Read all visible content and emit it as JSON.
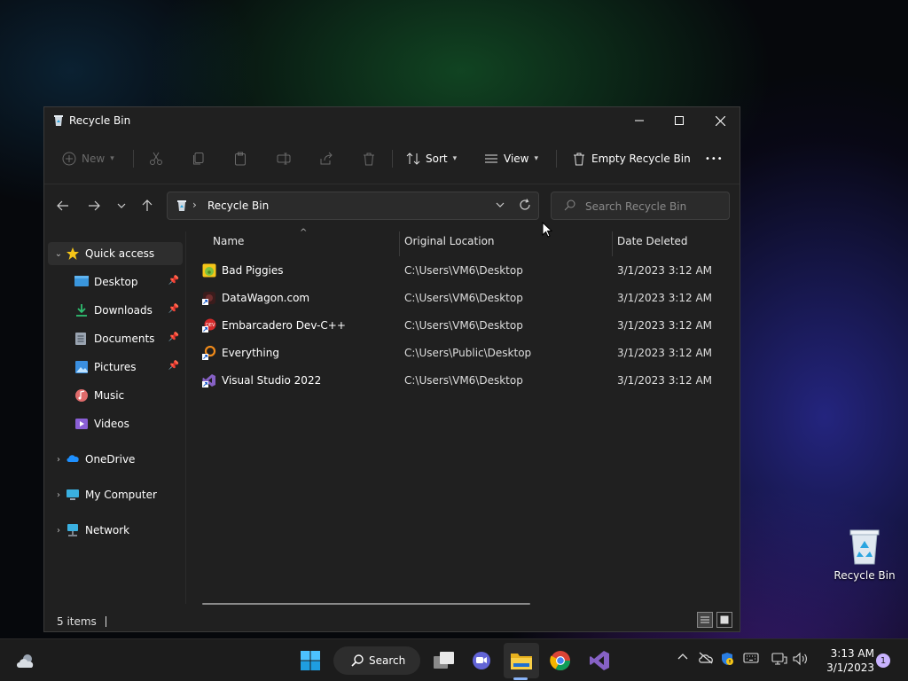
{
  "window": {
    "title": "Recycle Bin",
    "controls": {
      "minimize": "—",
      "maximize": "☐",
      "close": "✕"
    }
  },
  "toolbar": {
    "new_label": "New",
    "sort_label": "Sort",
    "view_label": "View",
    "empty_label": "Empty Recycle Bin",
    "more_label": "•••"
  },
  "address": {
    "path": "Recycle Bin",
    "search_placeholder": "Search Recycle Bin"
  },
  "sidebar": {
    "quick_access": "Quick access",
    "pinned": [
      {
        "label": "Desktop",
        "icon": "desktop-folder-icon",
        "color": "#3a96dd"
      },
      {
        "label": "Downloads",
        "icon": "downloads-folder-icon",
        "color": "#2fbf71"
      },
      {
        "label": "Documents",
        "icon": "documents-folder-icon",
        "color": "#9aa4b1"
      },
      {
        "label": "Pictures",
        "icon": "pictures-folder-icon",
        "color": "#3a8fe0"
      },
      {
        "label": "Music",
        "icon": "music-folder-icon",
        "color": "#e06b6b"
      },
      {
        "label": "Videos",
        "icon": "videos-folder-icon",
        "color": "#8a5fd6"
      }
    ],
    "onedrive": "OneDrive",
    "my_computer": "My Computer",
    "network": "Network"
  },
  "columns": {
    "name": "Name",
    "location": "Original Location",
    "date": "Date Deleted"
  },
  "files": [
    {
      "name": "Bad Piggies",
      "location": "C:\\Users\\VM6\\Desktop",
      "date": "3/1/2023 3:12 AM",
      "icon": "bad-piggies-icon",
      "color": "#7cc242"
    },
    {
      "name": "DataWagon.com",
      "location": "C:\\Users\\VM6\\Desktop",
      "date": "3/1/2023 3:12 AM",
      "icon": "datawagon-icon",
      "color": "#5a2a2a"
    },
    {
      "name": "Embarcadero Dev-C++",
      "location": "C:\\Users\\VM6\\Desktop",
      "date": "3/1/2023 3:12 AM",
      "icon": "devcpp-icon",
      "color": "#d42a2a"
    },
    {
      "name": "Everything",
      "location": "C:\\Users\\Public\\Desktop",
      "date": "3/1/2023 3:12 AM",
      "icon": "everything-icon",
      "color": "#f08a1a"
    },
    {
      "name": "Visual Studio 2022",
      "location": "C:\\Users\\VM6\\Desktop",
      "date": "3/1/2023 3:12 AM",
      "icon": "visual-studio-icon",
      "color": "#8661c5"
    }
  ],
  "status": {
    "count": "5 items"
  },
  "desktop": {
    "recycle_label": "Recycle Bin"
  },
  "taskbar": {
    "search_label": "Search",
    "time": "3:13 AM",
    "date": "3/1/2023",
    "notifications": "1"
  }
}
